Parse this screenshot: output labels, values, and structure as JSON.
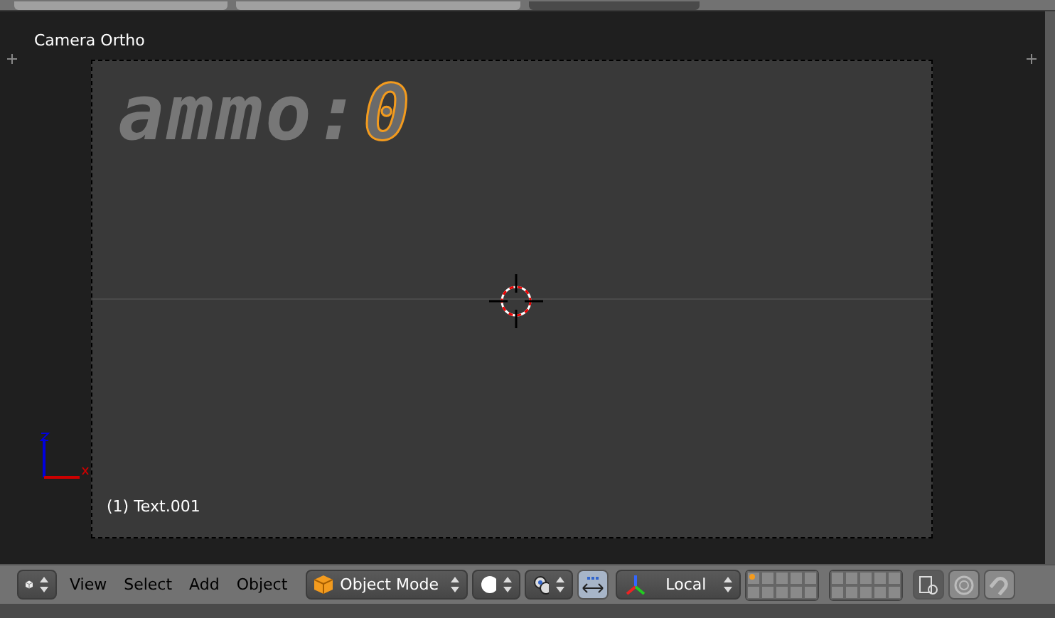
{
  "viewport": {
    "view_label": "Camera Ortho",
    "object_label": "(1) Text.001",
    "scene_text": {
      "prefix": "ammo:",
      "value": "0",
      "value_selected": true
    }
  },
  "header": {
    "menus": [
      "View",
      "Select",
      "Add",
      "Object"
    ],
    "mode": "Object Mode",
    "orientation": "Local",
    "manipulator_on": true,
    "layers": [
      {
        "has_objects": true
      },
      {
        "has_objects": false
      },
      {
        "has_objects": false
      },
      {
        "has_objects": false
      },
      {
        "has_objects": false
      },
      {
        "has_objects": false
      },
      {
        "has_objects": false
      },
      {
        "has_objects": false
      },
      {
        "has_objects": false
      },
      {
        "has_objects": false
      },
      {
        "has_objects": false
      },
      {
        "has_objects": false
      },
      {
        "has_objects": false
      },
      {
        "has_objects": false
      },
      {
        "has_objects": false
      },
      {
        "has_objects": false
      },
      {
        "has_objects": false
      },
      {
        "has_objects": false
      },
      {
        "has_objects": false
      },
      {
        "has_objects": false
      }
    ]
  }
}
